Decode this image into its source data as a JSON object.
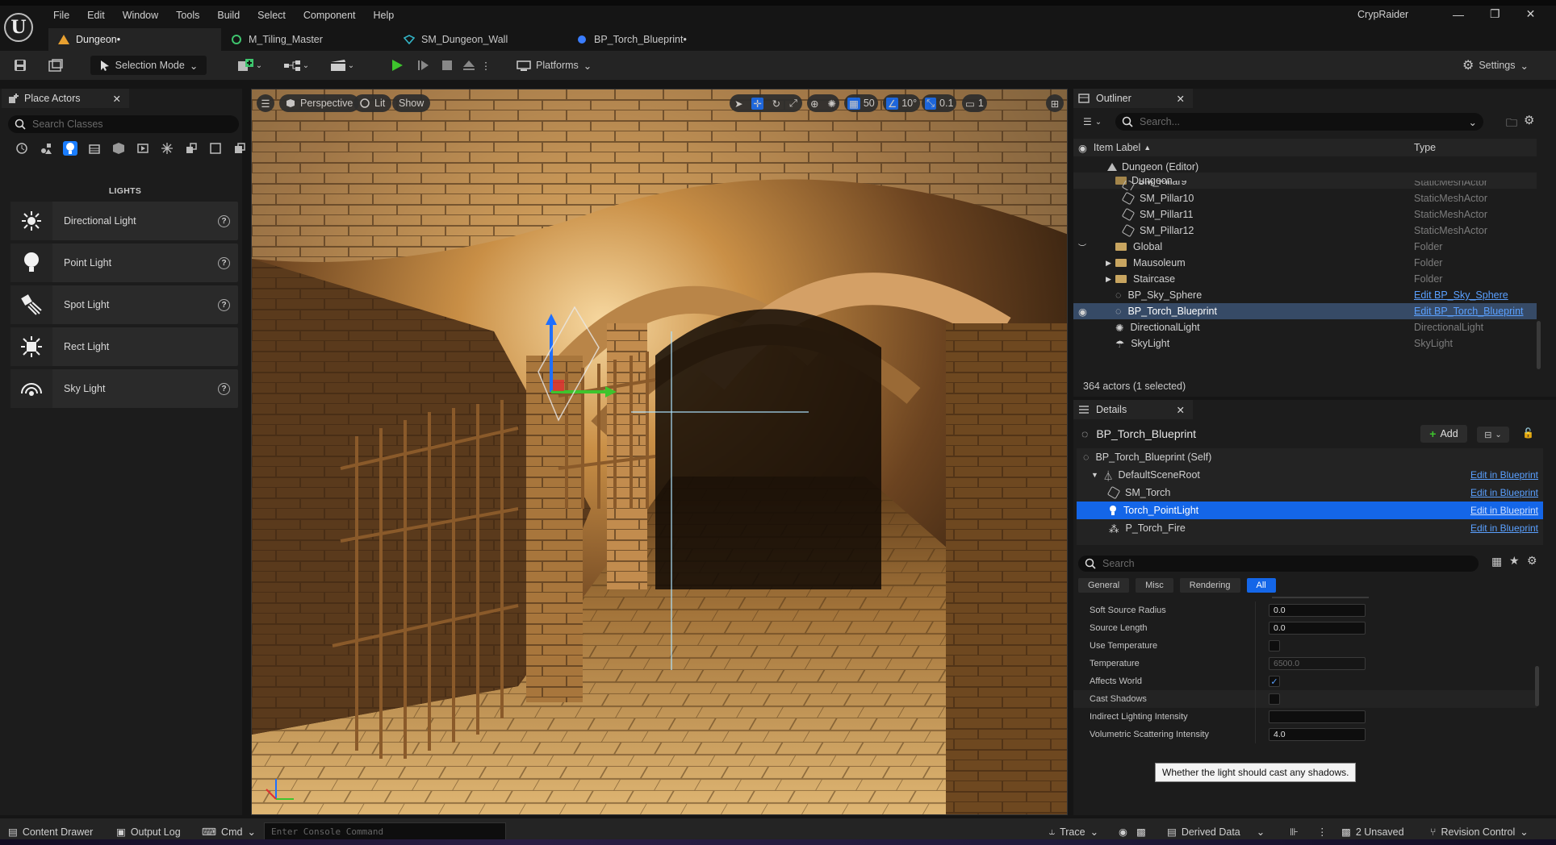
{
  "app": {
    "logo": "U",
    "menu": [
      "File",
      "Edit",
      "Window",
      "Tools",
      "Build",
      "Select",
      "Component",
      "Help"
    ],
    "project": "CrypRaider",
    "window_buttons": [
      "—",
      "❐",
      "✕"
    ]
  },
  "tabs": [
    {
      "label": "Dungeon•",
      "icon": "level-icon",
      "color": "#e8a030"
    },
    {
      "label": "M_Tiling_Master",
      "icon": "material-icon",
      "color": "#3ec46d"
    },
    {
      "label": "SM_Dungeon_Wall",
      "icon": "static-mesh-icon",
      "color": "#33b3c4"
    },
    {
      "label": "BP_Torch_Blueprint•",
      "icon": "blueprint-icon",
      "color": "#3a7dff"
    }
  ],
  "toolbar": {
    "selection_mode": "Selection Mode",
    "platforms": "Platforms",
    "settings": "Settings"
  },
  "place_actors": {
    "tab_label": "Place Actors",
    "search_placeholder": "Search Classes",
    "category_header": "LIGHTS",
    "items": [
      {
        "label": "Directional Light",
        "icon": "directional-light-icon"
      },
      {
        "label": "Point Light",
        "icon": "point-light-icon"
      },
      {
        "label": "Spot Light",
        "icon": "spot-light-icon"
      },
      {
        "label": "Rect Light",
        "icon": "rect-light-icon"
      },
      {
        "label": "Sky Light",
        "icon": "sky-light-icon"
      }
    ]
  },
  "viewport": {
    "perspective": "Perspective",
    "lit": "Lit",
    "show": "Show",
    "grid_snap": "50",
    "rot_snap": "10°",
    "scale_snap": "0.1",
    "camera_speed": "1"
  },
  "outliner": {
    "tab_label": "Outliner",
    "search_placeholder": "Search...",
    "col_label": "Item Label",
    "col_type": "Type",
    "rows": [
      {
        "label": "Dungeon (Editor)",
        "type": "",
        "icon": "level"
      },
      {
        "label": "Dungeon",
        "type": "",
        "icon": "folder-open"
      },
      {
        "label": "SM_Pillar9",
        "type": "StaticMeshActor",
        "icon": "mesh"
      },
      {
        "label": "SM_Pillar10",
        "type": "StaticMeshActor",
        "icon": "mesh"
      },
      {
        "label": "SM_Pillar11",
        "type": "StaticMeshActor",
        "icon": "mesh"
      },
      {
        "label": "SM_Pillar12",
        "type": "StaticMeshActor",
        "icon": "mesh"
      },
      {
        "label": "Global",
        "type": "Folder",
        "icon": "folder"
      },
      {
        "label": "Mausoleum",
        "type": "Folder",
        "icon": "folder"
      },
      {
        "label": "Staircase",
        "type": "Folder",
        "icon": "folder"
      },
      {
        "label": "BP_Sky_Sphere",
        "type": "Edit BP_Sky_Sphere",
        "icon": "bp"
      },
      {
        "label": "BP_Torch_Blueprint",
        "type": "Edit BP_Torch_Blueprint",
        "icon": "bp"
      },
      {
        "label": "DirectionalLight",
        "type": "DirectionalLight",
        "icon": "sun"
      },
      {
        "label": "SkyLight",
        "type": "SkyLight",
        "icon": "sky"
      }
    ],
    "footer": "364 actors (1 selected)"
  },
  "details": {
    "tab_label": "Details",
    "title": "BP_Torch_Blueprint",
    "add_label": "Add",
    "components": [
      {
        "label": "BP_Torch_Blueprint (Self)",
        "edit": ""
      },
      {
        "label": "DefaultSceneRoot",
        "edit": "Edit in Blueprint"
      },
      {
        "label": "SM_Torch",
        "edit": "Edit in Blueprint"
      },
      {
        "label": "Torch_PointLight",
        "edit": "Edit in Blueprint"
      },
      {
        "label": "P_Torch_Fire",
        "edit": "Edit in Blueprint"
      }
    ],
    "search_placeholder": "Search",
    "filters": [
      "General",
      "Misc",
      "Rendering",
      "All"
    ],
    "properties": [
      {
        "name": "Soft Source Radius",
        "value": "0.0",
        "kind": "num"
      },
      {
        "name": "Source Length",
        "value": "0.0",
        "kind": "num"
      },
      {
        "name": "Use Temperature",
        "value": "",
        "kind": "check"
      },
      {
        "name": "Temperature",
        "value": "6500.0",
        "kind": "dim"
      },
      {
        "name": "Affects World",
        "value": "✓",
        "kind": "check"
      },
      {
        "name": "Cast Shadows",
        "value": "",
        "kind": "check"
      },
      {
        "name": "Indirect Lighting Intensity",
        "value": "",
        "kind": "num"
      },
      {
        "name": "Volumetric Scattering Intensity",
        "value": "4.0",
        "kind": "num"
      }
    ],
    "tooltip": "Whether the light should cast any shadows."
  },
  "statusbar": {
    "content_drawer": "Content Drawer",
    "output_log": "Output Log",
    "cmd": "Cmd",
    "console_placeholder": "Enter Console Command",
    "trace": "Trace",
    "derived_data": "Derived Data",
    "unsaved": "2 Unsaved",
    "revision_control": "Revision Control"
  }
}
